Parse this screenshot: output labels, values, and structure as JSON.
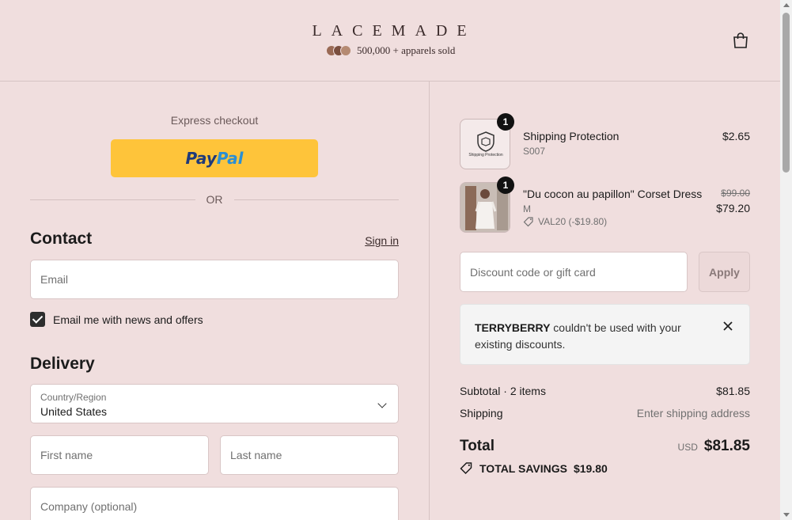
{
  "header": {
    "logo": "LACEMADE",
    "sold_text": "500,000 + apparels sold",
    "cart_icon": "shopping-bag-icon"
  },
  "express": {
    "title": "Express checkout",
    "paypal_part1": "Pay",
    "paypal_part2": "Pal",
    "or_text": "OR"
  },
  "contact": {
    "title": "Contact",
    "signin": "Sign in",
    "email_placeholder": "Email",
    "newsletter_label": "Email me with news and offers",
    "newsletter_checked": true
  },
  "delivery": {
    "title": "Delivery",
    "country_label": "Country/Region",
    "country_value": "United States",
    "first_name_placeholder": "First name",
    "last_name_placeholder": "Last name",
    "company_placeholder": "Company (optional)"
  },
  "order": {
    "items": [
      {
        "quantity": "1",
        "name": "Shipping Protection",
        "sub": "S007",
        "price": "$2.65",
        "thumb_text": "Shipping Protection"
      },
      {
        "quantity": "1",
        "name": "\"Du cocon au papillon\" Corset Dress",
        "sub": "M",
        "discount": "VAL20 (-$19.80)",
        "old_price": "$99.00",
        "price": "$79.20"
      }
    ],
    "discount_placeholder": "Discount code or gift card",
    "apply_label": "Apply",
    "notice_code": "TERRYBERRY",
    "notice_text": " couldn't be used with your existing discounts.",
    "subtotal_label": "Subtotal · 2 items",
    "subtotal_value": "$81.85",
    "shipping_label": "Shipping",
    "shipping_value": "Enter shipping address",
    "total_label": "Total",
    "currency": "USD",
    "total_value": "$81.85",
    "savings_label": "TOTAL SAVINGS",
    "savings_value": "$19.80"
  },
  "colors": {
    "background": "#f0dede",
    "paypal_yellow": "#fec43a",
    "paypal_navy": "#1f3a7a",
    "paypal_blue": "#2b8fd4"
  }
}
